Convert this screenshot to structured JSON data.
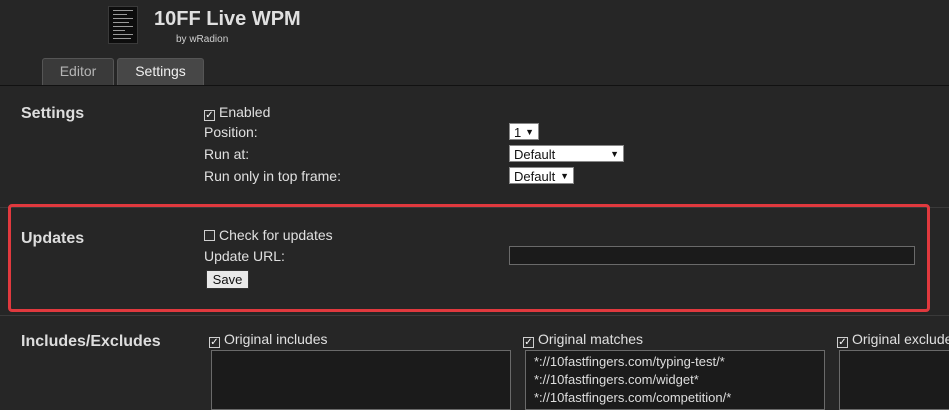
{
  "header": {
    "title": "10FF Live WPM",
    "subtitle": "by wRadion"
  },
  "tabs": [
    {
      "label": "Editor",
      "active": false
    },
    {
      "label": "Settings",
      "active": true
    }
  ],
  "settings": {
    "title": "Settings",
    "enabled_label": "Enabled",
    "enabled_checked": true,
    "position_label": "Position:",
    "position_value": "1",
    "run_at_label": "Run at:",
    "run_at_value": "Default",
    "top_frame_label": "Run only in top frame:",
    "top_frame_value": "Default"
  },
  "updates": {
    "title": "Updates",
    "check_label": "Check for updates",
    "check_checked": false,
    "url_label": "Update URL:",
    "url_value": "",
    "save_label": "Save",
    "highlight_color": "#e0393e"
  },
  "includes": {
    "title": "Includes/Excludes",
    "original_includes_label": "Original includes",
    "original_includes": [],
    "original_matches_label": "Original matches",
    "original_matches": [
      "*://10fastfingers.com/typing-test/*",
      "*://10fastfingers.com/widget*",
      "*://10fastfingers.com/competition/*"
    ],
    "original_excludes_label": "Original exclude"
  }
}
